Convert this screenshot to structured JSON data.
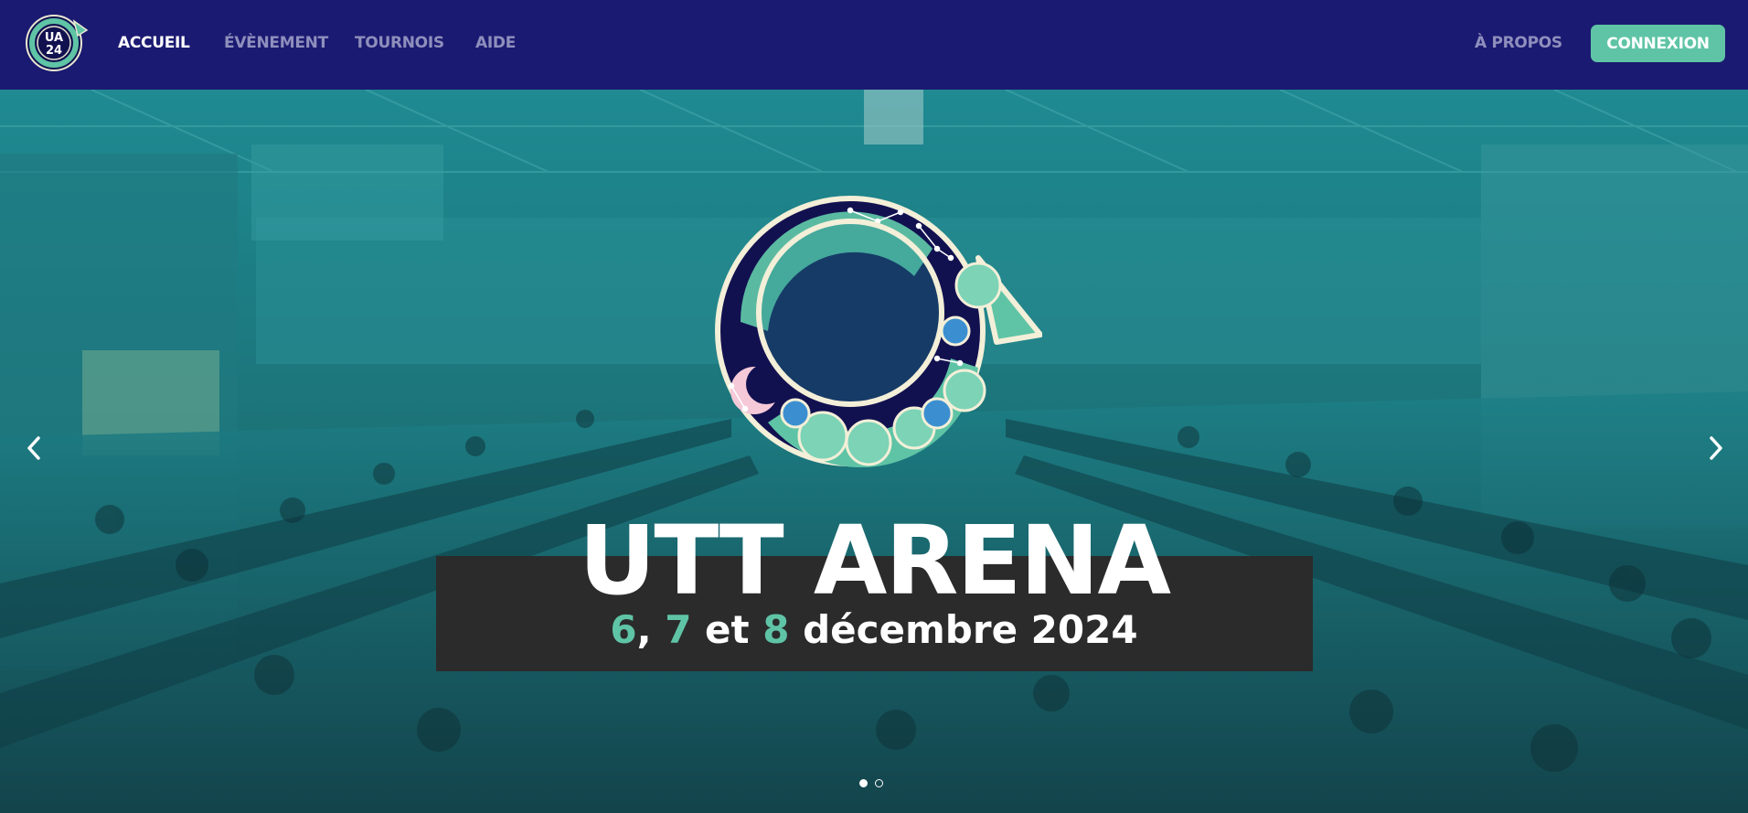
{
  "nav": {
    "logo_text_line1": "UA",
    "logo_text_line2": "24",
    "links": [
      {
        "label": "ACCUEIL",
        "active": true
      },
      {
        "label": "ÉVÈNEMENT",
        "active": false
      },
      {
        "label": "TOURNOIS",
        "active": false
      },
      {
        "label": "AIDE",
        "active": false
      }
    ],
    "about_label": "À PROPOS",
    "login_label": "CONNEXION"
  },
  "hero": {
    "title": "UTT ARENA",
    "date_day1": "6",
    "date_sep1": ", ",
    "date_day2": "7",
    "date_sep2": " et ",
    "date_day3": "8",
    "date_rest": " décembre 2024",
    "prev_icon": "chevron-left-icon",
    "next_icon": "chevron-right-icon",
    "slides_count": 2,
    "active_slide": 1
  },
  "colors": {
    "nav_bg": "#1b1a72",
    "accent": "#5fc4a5",
    "title_box": "#2b2b2b",
    "nav_link": "#8f8fbd"
  }
}
